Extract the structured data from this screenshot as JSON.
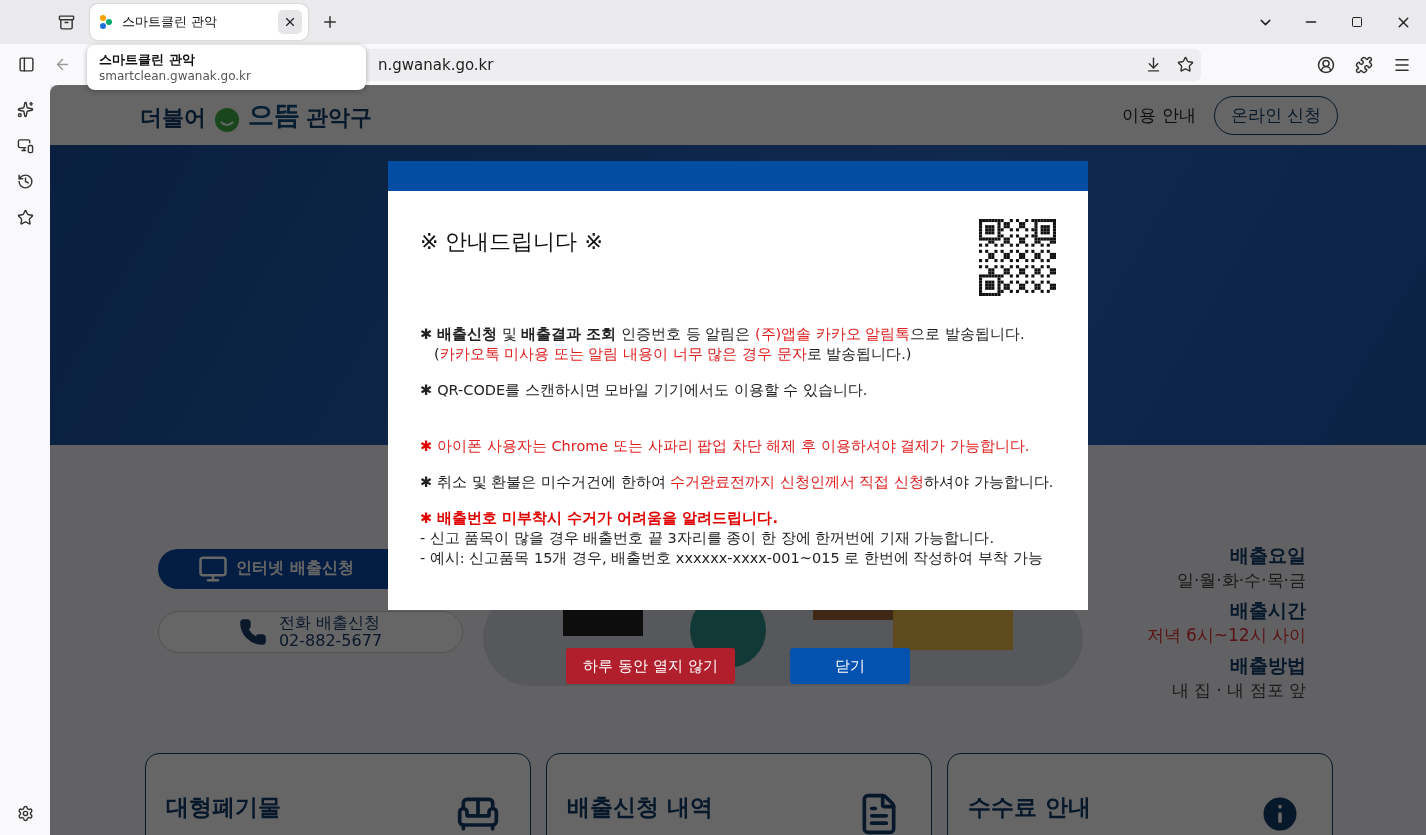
{
  "browser": {
    "tabs": [
      {
        "title": "스마트클린 관악",
        "selected": true
      }
    ],
    "address": "n.gwanak.go.kr",
    "tooltip": {
      "title": "스마트클린 관악",
      "url": "smartclean.gwanak.go.kr"
    }
  },
  "site": {
    "logo": [
      "더불어",
      "으뜸",
      "관악구"
    ],
    "nav": [
      {
        "label": "이용 안내",
        "kind": "link"
      },
      {
        "label": "온라인 신청",
        "kind": "outline"
      }
    ],
    "actions": [
      {
        "kind": "internet",
        "lines": [
          "인터넷 배출신청"
        ]
      },
      {
        "kind": "phone",
        "lines": [
          "전화 배출신청",
          "02-882-5677"
        ]
      }
    ],
    "schedule": [
      {
        "heading": "배출요일",
        "value": "일·월·화·수·목·금",
        "kind": "plain"
      },
      {
        "heading": "배출시간",
        "value": "저녁 6시~12시 사이",
        "kind": "red"
      },
      {
        "heading": "배출방법",
        "value": "내 집 · 내 점포 앞",
        "kind": "plain"
      }
    ],
    "cards": [
      {
        "title": "대형폐기물",
        "kind": "sofa"
      },
      {
        "title": "배출신청 내역",
        "kind": "document"
      },
      {
        "title": "수수료 안내",
        "kind": "info"
      }
    ]
  },
  "modal": {
    "title": "※ 안내드립니다 ※",
    "paragraphs": [
      {
        "lines": [
          [
            {
              "text": "✱ ",
              "kind": "bold"
            },
            {
              "text": "배출신청",
              "kind": "bold"
            },
            {
              "text": " 및 ",
              "kind": "plain"
            },
            {
              "text": "배출결과 조회",
              "kind": "bold"
            },
            {
              "text": " 인증번호 등 알림은 ",
              "kind": "plain"
            },
            {
              "text": "(주)앱솔 카카오 알림톡",
              "kind": "red"
            },
            {
              "text": "으로 발송됩니다.",
              "kind": "plain"
            }
          ],
          [
            {
              "text": "(",
              "kind": "plain"
            },
            {
              "text": "카카오톡 미사용 또는 알림 내용이 너무 많은 경우 문자",
              "kind": "red"
            },
            {
              "text": "로 발송됩니다.)",
              "kind": "plain"
            }
          ]
        ]
      },
      {
        "lines": [
          [
            {
              "text": "✱ ",
              "kind": "bold"
            },
            {
              "text": "QR-CODE를 스캔하시면 모바일 기기에서도 이용할 수 있습니다.",
              "kind": "plain"
            }
          ]
        ]
      },
      {
        "lines": [
          [
            {
              "text": "✱ ",
              "kind": "alert"
            },
            {
              "text": "아이폰 사용자는 Chrome 또는 사파리 팝업 차단 해제 후 이용하셔야 결제가 가능합니다.",
              "kind": "red"
            }
          ]
        ]
      },
      {
        "lines": [
          [
            {
              "text": "✱ ",
              "kind": "bold"
            },
            {
              "text": "취소 및 환불은 미수거건에 한하여 ",
              "kind": "plain"
            },
            {
              "text": "수거완료전까지 신청인께서 직접 신청",
              "kind": "red"
            },
            {
              "text": "하셔야 가능합니다.",
              "kind": "plain"
            }
          ]
        ]
      },
      {
        "lines": [
          [
            {
              "text": "✱ 배출번호 미부착시 수거가 어려움을 알려드립니다.",
              "kind": "alert"
            }
          ],
          [
            {
              "text": "- 신고 품목이 많을 경우 배출번호 끝 3자리를 종이 한 장에 한꺼번에 기재 가능합니다.",
              "kind": "plain"
            }
          ],
          [
            {
              "text": "- 예시: 신고품목 15개 경우, 배출번호 xxxxxx-xxxx-001~015 로 한번에 작성하여 부착 가능",
              "kind": "plain"
            }
          ]
        ]
      }
    ],
    "buttons": [
      {
        "label": "하루 동안 열지 않기",
        "kind": "dismiss"
      },
      {
        "label": "닫기",
        "kind": "close"
      }
    ]
  }
}
